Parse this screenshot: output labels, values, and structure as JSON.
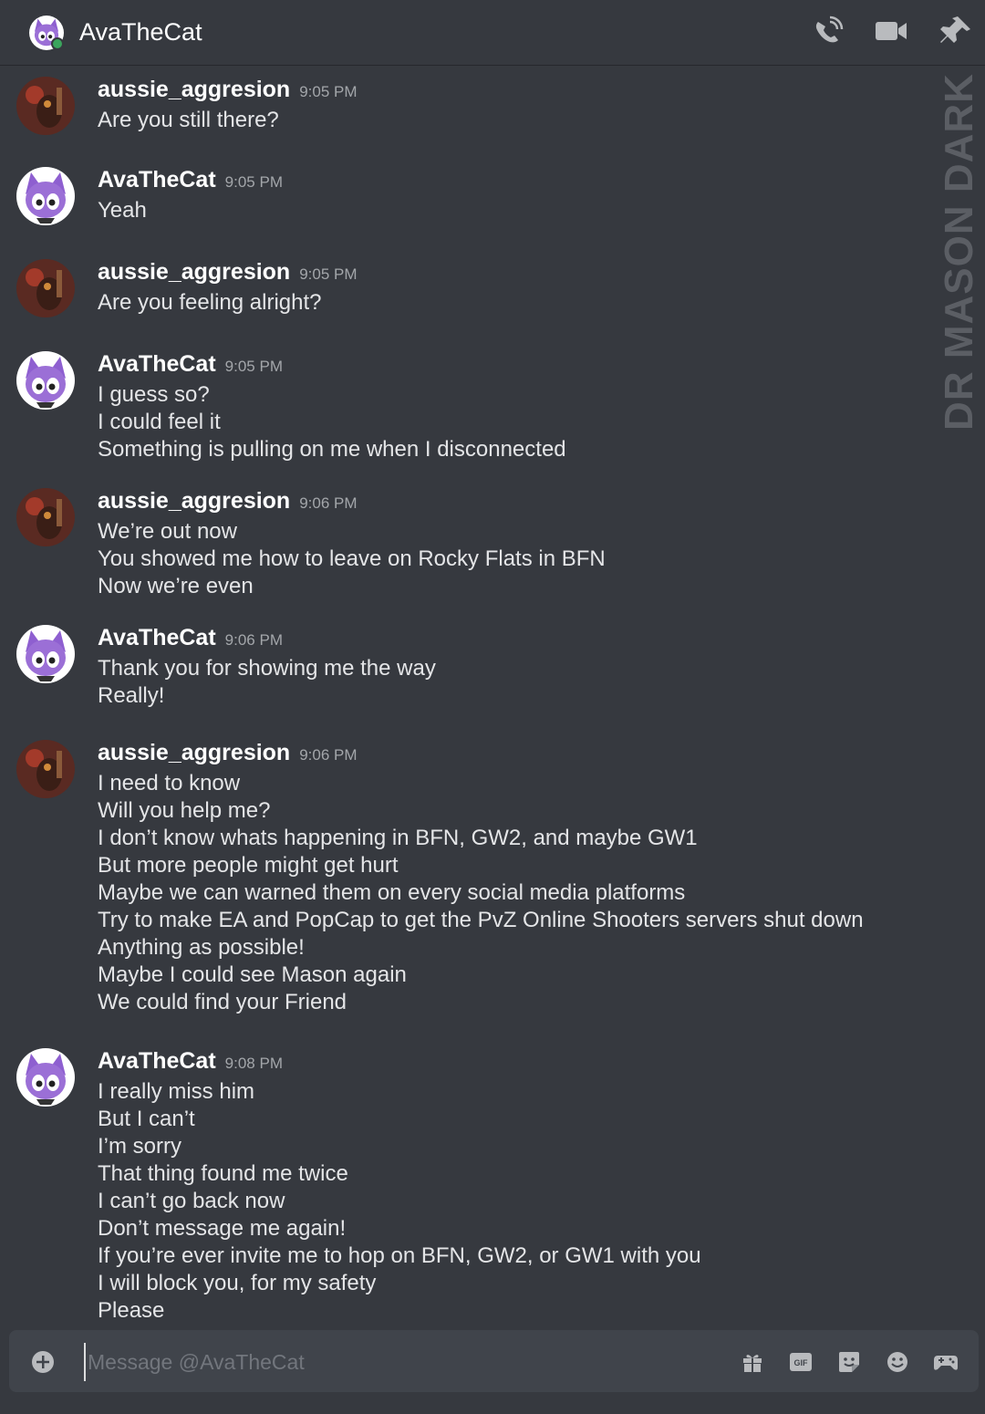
{
  "header": {
    "title": "AvaTheCat",
    "status_color": "#3ba55d",
    "icons": [
      "phone-call-icon",
      "video-camera-icon",
      "pin-icon"
    ]
  },
  "watermark": "DR MASON DARK",
  "messages": [
    {
      "author": "aussie_aggresion",
      "time": "9:05 PM",
      "avatar": "aussie",
      "lines": [
        "Are you still there?"
      ]
    },
    {
      "author": "AvaTheCat",
      "time": "9:05 PM",
      "avatar": "ava",
      "lines": [
        "Yeah"
      ]
    },
    {
      "author": "aussie_aggresion",
      "time": "9:05 PM",
      "avatar": "aussie",
      "lines": [
        "Are you feeling alright?"
      ]
    },
    {
      "author": "AvaTheCat",
      "time": "9:05 PM",
      "avatar": "ava",
      "lines": [
        "I guess so?",
        "I could feel it",
        "Something is pulling on me when I disconnected"
      ]
    },
    {
      "author": "aussie_aggresion",
      "time": "9:06 PM",
      "avatar": "aussie",
      "lines": [
        "We’re out now",
        "You showed me how to leave on Rocky Flats in BFN",
        "Now we’re even"
      ]
    },
    {
      "author": "AvaTheCat",
      "time": "9:06 PM",
      "avatar": "ava",
      "lines": [
        "Thank you for showing me the way",
        "Really!"
      ]
    },
    {
      "author": "aussie_aggresion",
      "time": "9:06 PM",
      "avatar": "aussie",
      "lines": [
        "I need to know",
        "Will you help me?",
        "I don’t know whats happening in BFN, GW2, and maybe GW1",
        "But more people might get hurt",
        "Maybe we can warned them on every social media platforms",
        "Try to make EA and PopCap to get the PvZ Online Shooters servers shut down",
        "Anything as possible!",
        "Maybe I could see Mason again",
        "We could find your Friend"
      ]
    },
    {
      "author": "AvaTheCat",
      "time": "9:08 PM",
      "avatar": "ava",
      "lines": [
        "I really miss him",
        "But I can’t",
        "I’m sorry",
        "That thing found me twice",
        "I can’t go back now",
        "Don’t message me again!",
        "If you’re ever invite me to hop on BFN, GW2, or GW1 with you",
        "I will block you, for my safety",
        "Please"
      ]
    }
  ],
  "composer": {
    "placeholder": "Message @AvaTheCat",
    "icons": [
      "add-attachment-icon",
      "gift-icon",
      "gif-icon",
      "sticker-icon",
      "emoji-icon",
      "game-controller-icon"
    ],
    "gif_label": "GIF"
  },
  "colors": {
    "background": "#36393f",
    "composer": "#40444b",
    "text": "#dcddde",
    "timestamp": "#a3a6aa",
    "ava_purple": "#9b6fd6"
  }
}
